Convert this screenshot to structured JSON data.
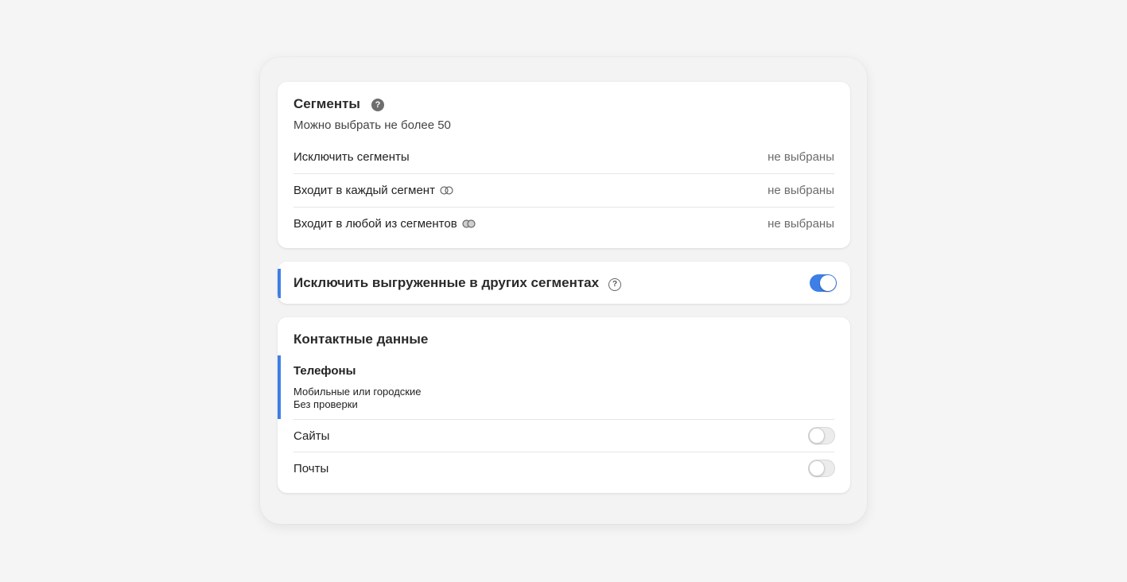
{
  "segments": {
    "title": "Сегменты",
    "help_icon": "question-circle-filled",
    "subtitle": "Можно выбрать не более 50",
    "rows": [
      {
        "label": "Исключить сегменты",
        "value": "не выбраны",
        "icon": null
      },
      {
        "label": "Входит в каждый сегмент",
        "value": "не выбраны",
        "icon": "intersect-rings-icon"
      },
      {
        "label": "Входит в любой из сегментов",
        "value": "не выбраны",
        "icon": "union-rings-icon"
      }
    ]
  },
  "exclude_exported": {
    "label": "Исключить выгруженные в других сегментах",
    "help_icon": "question-circle-outline",
    "enabled": true
  },
  "contacts": {
    "title": "Контактные данные",
    "phones": {
      "title": "Телефоны",
      "line1": "Мобильные или городские",
      "line2": "Без проверки"
    },
    "sites": {
      "label": "Сайты",
      "enabled": false
    },
    "emails": {
      "label": "Почты",
      "enabled": false
    }
  },
  "colors": {
    "accent": "#3d7fe6",
    "background": "#f5f5f5",
    "card": "#ffffff"
  }
}
